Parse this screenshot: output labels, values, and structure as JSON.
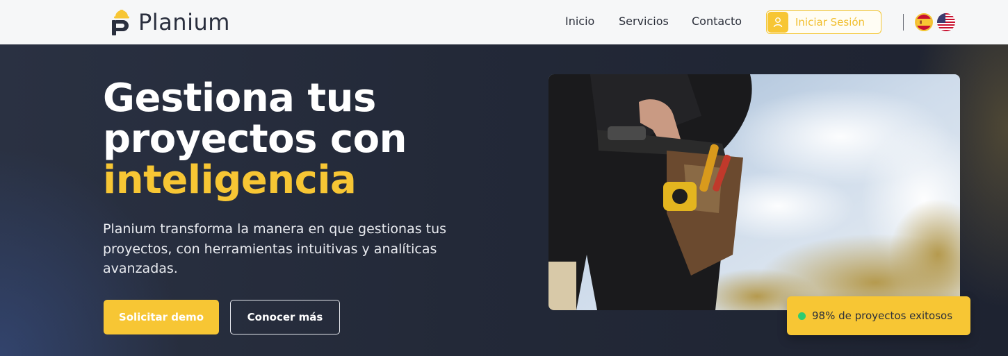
{
  "header": {
    "brand": "Planium",
    "nav": [
      {
        "label": "Inicio"
      },
      {
        "label": "Servicios"
      },
      {
        "label": "Contacto"
      }
    ],
    "login_label": "Iniciar Sesión",
    "languages": [
      {
        "name": "Español",
        "icon": "spain-flag-icon"
      },
      {
        "name": "English",
        "icon": "us-flag-icon"
      }
    ]
  },
  "hero": {
    "headline_line1": "Gestiona tus",
    "headline_line2": "proyectos con",
    "headline_accent": "inteligencia",
    "subtitle": "Planium transforma la manera en que gestionas tus proyectos, con herramientas intuitivas y analíticas avanzadas.",
    "primary_button": "Solicitar demo",
    "secondary_button": "Conocer más",
    "badge_text": "98% de proyectos exitosos"
  },
  "colors": {
    "accent": "#f7c634",
    "hero_background": "#232938",
    "header_background": "#f6f7f8",
    "status_green": "#2ecc71"
  }
}
